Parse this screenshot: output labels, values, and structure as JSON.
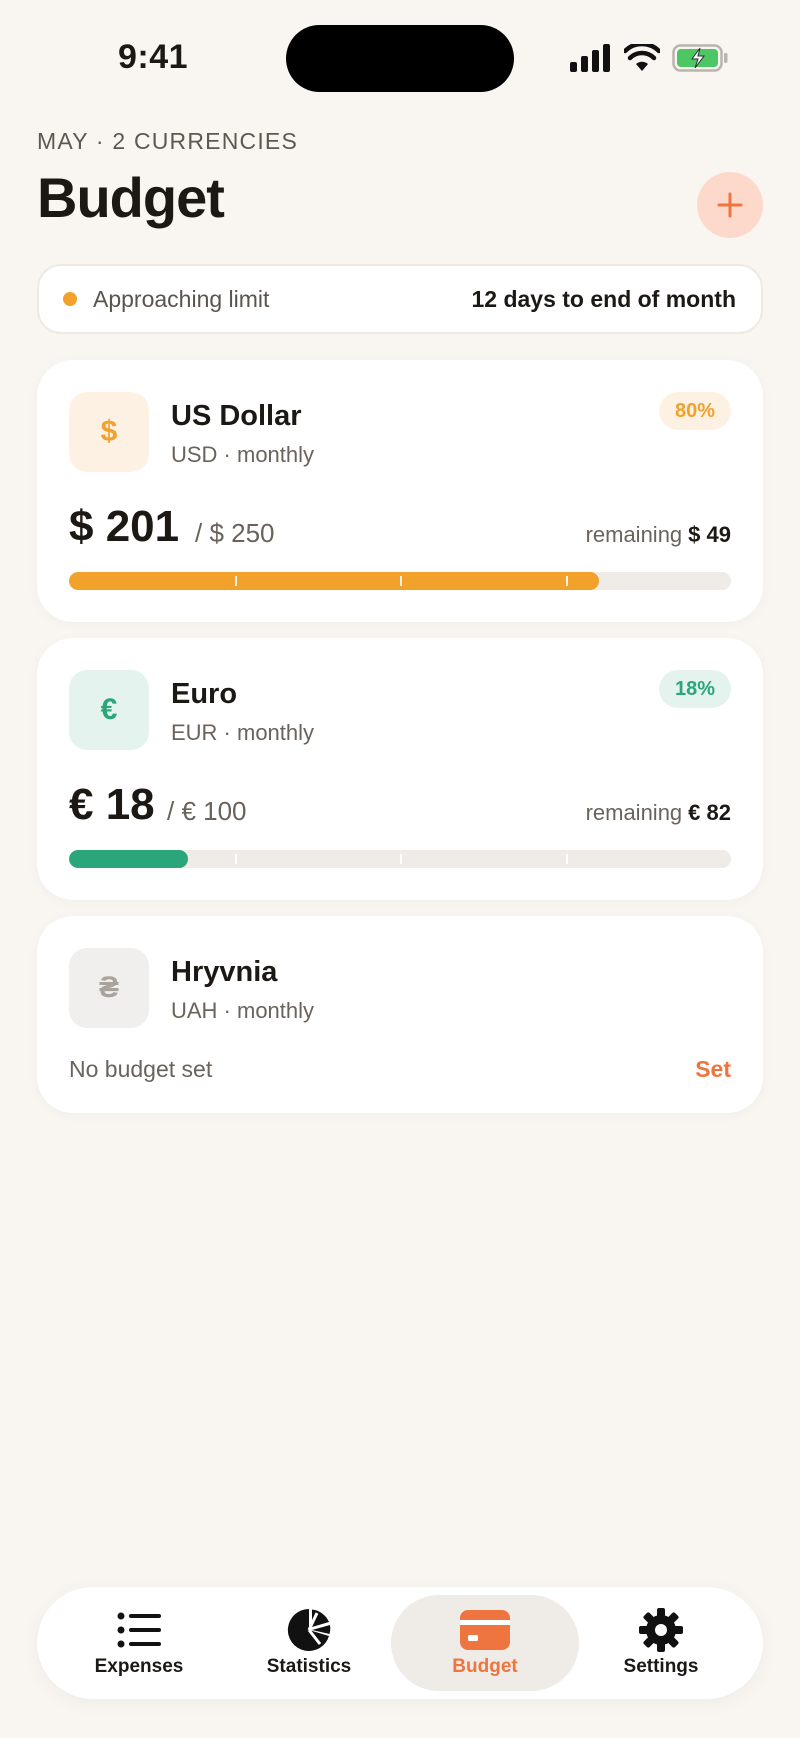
{
  "status": {
    "time": "9:41"
  },
  "header": {
    "subtitle": "MAY · 2 CURRENCIES",
    "title": "Budget",
    "add_label": "+"
  },
  "alert": {
    "text": "Approaching limit",
    "right": "12 days to end of month",
    "dot_color": "#f2a12a"
  },
  "budgets": [
    {
      "name": "US Dollar",
      "symbol": "$",
      "period": "USD · monthly",
      "percent": "80%",
      "spent": "$ 201",
      "limit": "/ $ 250",
      "remaining_label": "remaining",
      "remaining": "$ 49",
      "progress": 0.8,
      "color": "#f2a12a",
      "icon_bg": "#fdf1e4"
    },
    {
      "name": "Euro",
      "symbol": "€",
      "period": "EUR · monthly",
      "percent": "18%",
      "spent": "€ 18",
      "limit": "/ € 100",
      "remaining_label": "remaining",
      "remaining": "€ 82",
      "progress": 0.18,
      "color": "#2ba57a",
      "icon_bg": "#e4f3ee"
    },
    {
      "name": "Hryvnia",
      "symbol": "₴",
      "period": "UAH · monthly",
      "empty_text": "No budget set",
      "set_label": "Set",
      "icon_bg": "#f1efed"
    }
  ],
  "tabs": [
    {
      "label": "Expenses",
      "icon": "list-icon"
    },
    {
      "label": "Statistics",
      "icon": "pie-chart-icon"
    },
    {
      "label": "Budget",
      "icon": "card-icon",
      "active": true
    },
    {
      "label": "Settings",
      "icon": "gear-icon"
    }
  ],
  "colors": {
    "accent": "#ee7440",
    "background": "#f9f6f2"
  }
}
